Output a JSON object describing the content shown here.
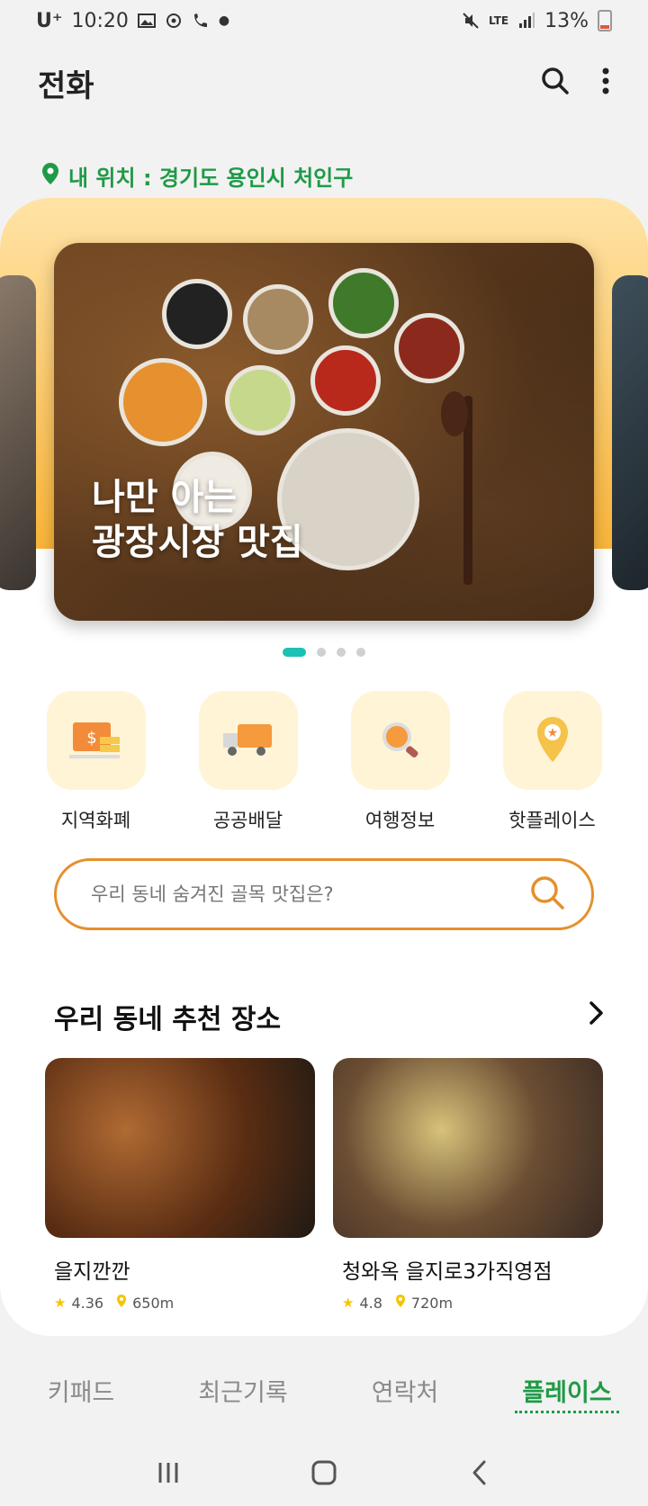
{
  "status_bar": {
    "carrier": "U⁺",
    "time": "10:20",
    "battery_pct": "13%",
    "network": "LTE"
  },
  "app_bar": {
    "title": "전화",
    "search_icon": "search-icon",
    "more_icon": "more-vert-icon"
  },
  "location": {
    "label": "내 위치 : 경기도 용인시 처인구"
  },
  "hero": {
    "title": "나만 아는\n광장시장 맛집",
    "page_count": 4,
    "active_page": 1
  },
  "quick_menu": [
    {
      "label": "지역화폐",
      "icon": "local-currency-icon"
    },
    {
      "label": "공공배달",
      "icon": "delivery-truck-icon"
    },
    {
      "label": "여행정보",
      "icon": "travel-search-icon"
    },
    {
      "label": "핫플레이스",
      "icon": "hot-place-pin-icon"
    }
  ],
  "search": {
    "placeholder": "우리 동네 숨겨진 골목 맛집은?"
  },
  "recommend": {
    "title": "우리 동네 추천 장소",
    "items": [
      {
        "name": "을지깐깐",
        "rating": "4.36",
        "distance": "650m"
      },
      {
        "name": "청와옥 을지로3가직영점",
        "rating": "4.8",
        "distance": "720m"
      }
    ]
  },
  "tabs": [
    {
      "label": "키패드",
      "active": false
    },
    {
      "label": "최근기록",
      "active": false
    },
    {
      "label": "연락처",
      "active": false
    },
    {
      "label": "플레이스",
      "active": true
    }
  ],
  "colors": {
    "accent_green": "#1f9a47",
    "accent_orange": "#e5902c",
    "dot_active": "#1bc1b4"
  }
}
